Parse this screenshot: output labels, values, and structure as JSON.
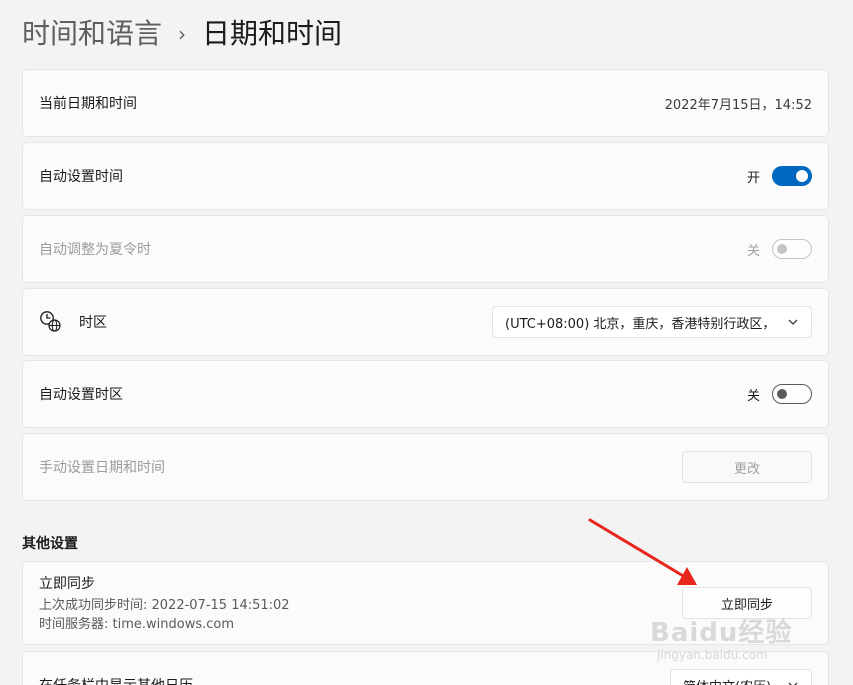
{
  "breadcrumb": {
    "parent": "时间和语言",
    "separator": "›",
    "current": "日期和时间"
  },
  "current_datetime": {
    "label": "当前日期和时间",
    "value": "2022年7月15日，14:52"
  },
  "auto_time": {
    "label": "自动设置时间",
    "state": "开",
    "on": true
  },
  "auto_dst": {
    "label": "自动调整为夏令时",
    "state": "关",
    "on": false,
    "disabled": true
  },
  "timezone": {
    "label": "时区",
    "icon": "globe-clock-icon",
    "selected": "(UTC+08:00) 北京，重庆，香港特别行政区，"
  },
  "auto_timezone": {
    "label": "自动设置时区",
    "state": "关",
    "on": false
  },
  "manual_set": {
    "label": "手动设置日期和时间",
    "button": "更改",
    "disabled": true
  },
  "other_settings": {
    "title": "其他设置"
  },
  "sync": {
    "label": "立即同步",
    "last_sync": "上次成功同步时间: 2022-07-15 14:51:02",
    "server": "时间服务器: time.windows.com",
    "button": "立即同步"
  },
  "calendar": {
    "label": "在任务栏中显示其他日历",
    "selected": "简体中文(农历)"
  },
  "watermark": {
    "main": "Baidu经验",
    "sub": "jingyan.baidu.com"
  },
  "colors": {
    "accent": "#0067c0",
    "arrow": "#e8261d",
    "background": "#f3f3f3",
    "card": "#fbfbfb"
  }
}
